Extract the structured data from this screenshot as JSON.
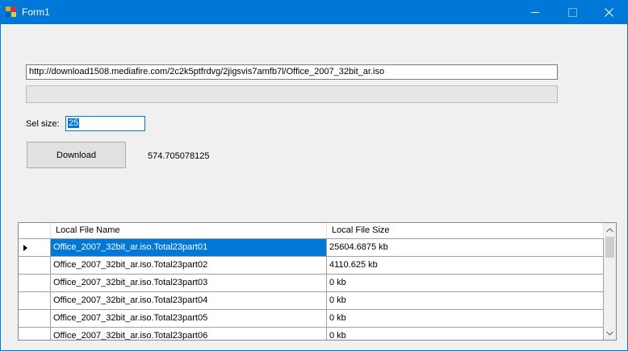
{
  "window": {
    "title": "Form1"
  },
  "icons": {
    "app": "winforms-app-icon",
    "minimize": "minimize-icon",
    "maximize": "maximize-icon",
    "close": "close-icon"
  },
  "url_input": {
    "value": "http://download1508.mediafire.com/2c2k5ptfrdvg/2jigsvis7amfb7l/Office_2007_32bit_ar.iso"
  },
  "progress": {
    "value_percent": 0
  },
  "sel_size": {
    "label": "Sel size:",
    "value": "25"
  },
  "download_button": {
    "label": "Download"
  },
  "size_value": "574.705078125",
  "grid": {
    "columns": [
      "Local File Name",
      "Local File Size"
    ],
    "rows": [
      {
        "name": "Office_2007_32bit_ar.iso.Total23part01",
        "size": "25604.6875 kb",
        "selected": true
      },
      {
        "name": "Office_2007_32bit_ar.iso.Total23part02",
        "size": "4110.625 kb",
        "selected": false
      },
      {
        "name": "Office_2007_32bit_ar.iso.Total23part03",
        "size": "0 kb",
        "selected": false
      },
      {
        "name": "Office_2007_32bit_ar.iso.Total23part04",
        "size": "0 kb",
        "selected": false
      },
      {
        "name": "Office_2007_32bit_ar.iso.Total23part05",
        "size": "0 kb",
        "selected": false
      },
      {
        "name": "Office_2007_32bit_ar.iso.Total23part06",
        "size": "0 kb",
        "selected": false
      }
    ]
  },
  "colors": {
    "titlebar": "#0078d7",
    "selection": "#0078d7",
    "window_bg": "#f0f0f0"
  }
}
